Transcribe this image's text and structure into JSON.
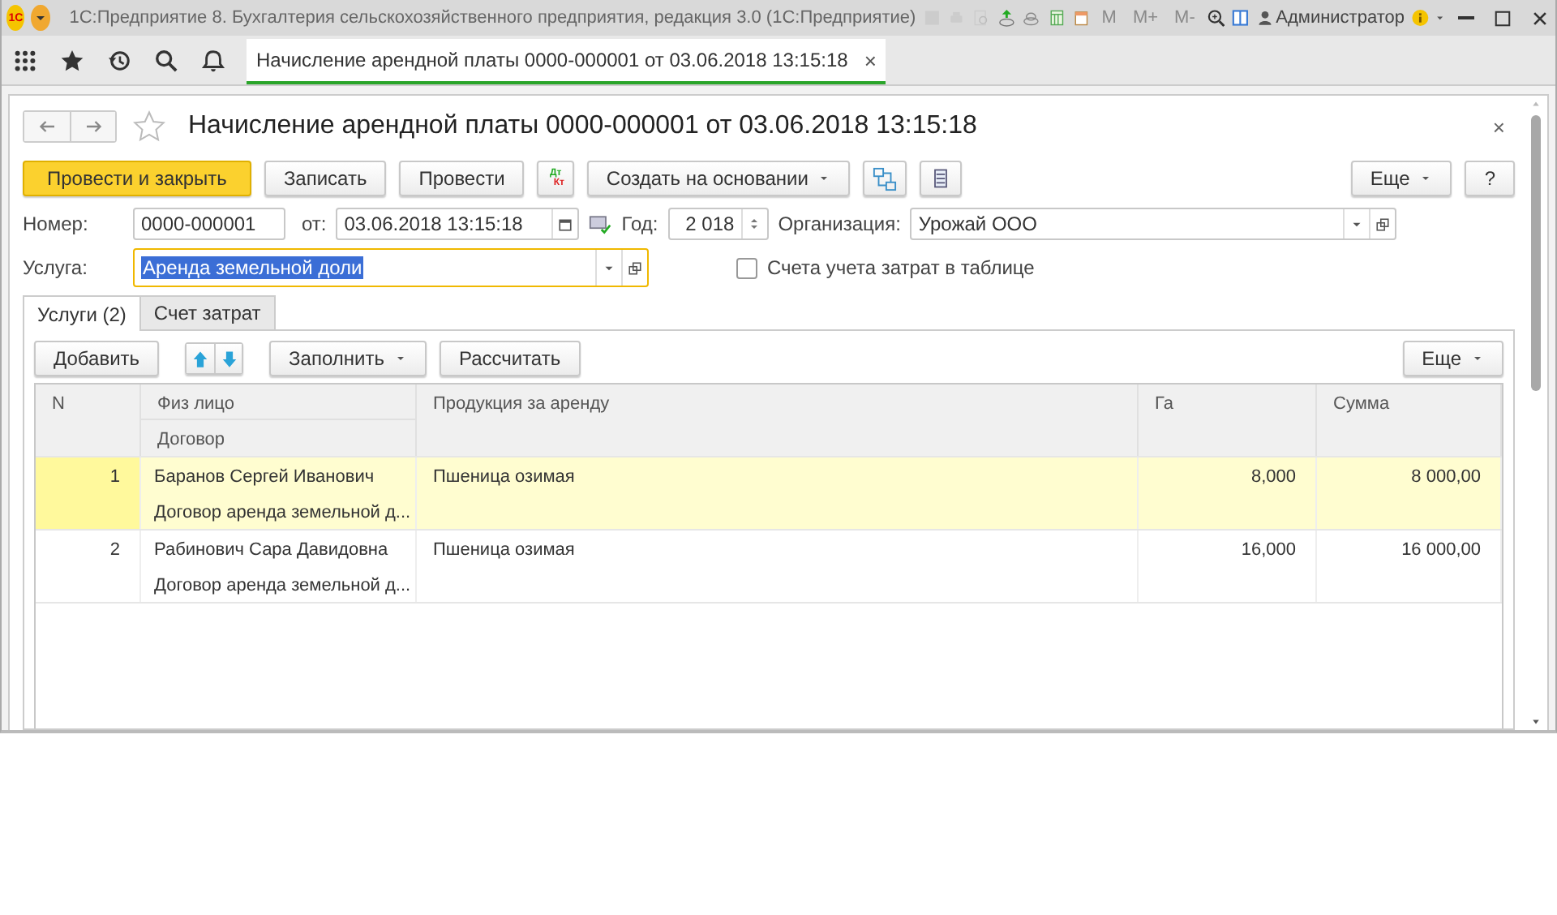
{
  "window": {
    "logo_text": "1С",
    "title": "1С:Предприятие 8. Бухгалтерия сельскохозяйственного предприятия, редакция 3.0  (1С:Предприятие)",
    "memory_buttons": [
      "M",
      "M+",
      "M-"
    ],
    "user": "Администратор"
  },
  "open_tabs": [
    {
      "label": "Начисление арендной платы 0000-000001 от 03.06.2018 13:15:18",
      "close": "×",
      "selected": true
    }
  ],
  "form": {
    "title": "Начисление арендной платы 0000-000001 от 03.06.2018 13:15:18",
    "close": "×",
    "commands": [
      {
        "kind": "primary",
        "label": "Провести и закрыть"
      },
      {
        "kind": "plain",
        "label": "Записать"
      },
      {
        "kind": "plain",
        "label": "Провести"
      },
      {
        "kind": "dtkt",
        "debit": "Дт",
        "credit": "Кт"
      },
      {
        "kind": "menu",
        "label": "Создать на основании"
      },
      {
        "kind": "structure"
      },
      {
        "kind": "list"
      }
    ],
    "more": "Еще",
    "help": "?",
    "number": {
      "label": "Номер:",
      "value": "0000-000001"
    },
    "date": {
      "label": "от:",
      "value": "03.06.2018 13:15:18"
    },
    "year": {
      "label": "Год:",
      "value": "2 018"
    },
    "organization": {
      "label": "Организация:",
      "value": "Урожай ООО"
    },
    "service": {
      "label": "Услуга:",
      "value": "Аренда земельной доли",
      "focused": true
    },
    "cost_accounts_in_table": {
      "label": "Счета учета затрат в таблице",
      "checked": false
    },
    "tabs": [
      {
        "label": "Услуги (2)",
        "selected": true
      },
      {
        "label": "Счет затрат",
        "selected": false
      }
    ],
    "table_toolbar": {
      "add": "Добавить",
      "fill": "Заполнить",
      "calculate": "Рассчитать",
      "more": "Еще"
    },
    "table": {
      "columns": [
        {
          "label": "N"
        },
        {
          "label": "Физ лицо",
          "sub_label": "Договор"
        },
        {
          "label": "Продукция за аренду"
        },
        {
          "label": "Га"
        },
        {
          "label": "Сумма"
        }
      ],
      "rows": [
        {
          "n": "1",
          "person": "Баранов Сергей Иванович",
          "contract": "Договор аренда земельной д...",
          "product": "Пшеница озимая",
          "ha": "8,000",
          "sum": "8 000,00",
          "selected": true
        },
        {
          "n": "2",
          "person": "Рабинович Сара Давидовна",
          "contract": "Договор аренда земельной д...",
          "product": "Пшеница озимая",
          "ha": "16,000",
          "sum": "16 000,00",
          "selected": false
        }
      ]
    }
  }
}
